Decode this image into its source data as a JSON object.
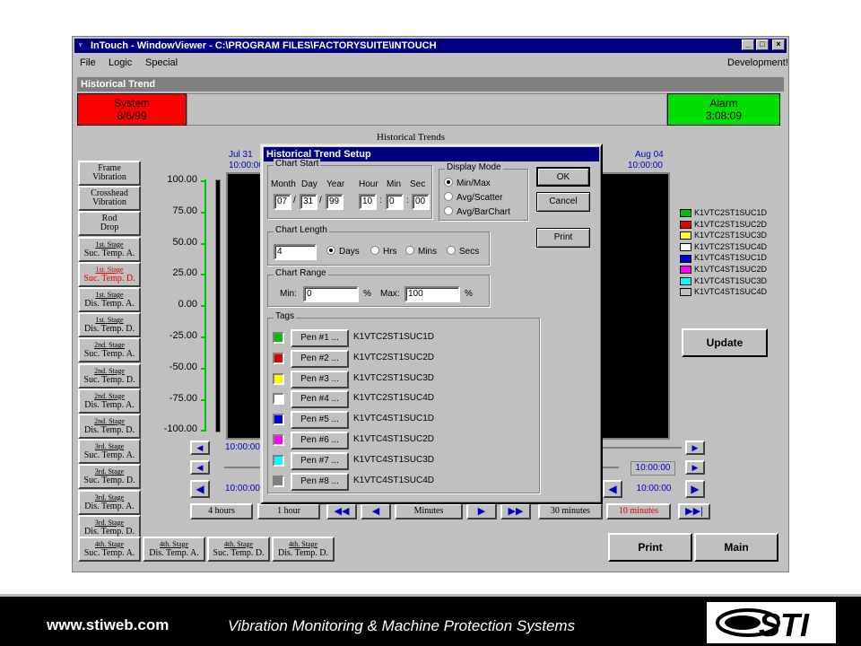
{
  "window": {
    "title": "InTouch - WindowViewer - C:\\PROGRAM FILES\\FACTORYSUITE\\INTOUCH",
    "min": "_",
    "max": "□",
    "close": "×"
  },
  "menu": {
    "file": "File",
    "logic": "Logic",
    "special": "Special",
    "right": "Development!"
  },
  "panel": {
    "title": "Historical Trend"
  },
  "system": {
    "label": "System",
    "date": "8/6/99"
  },
  "alarm": {
    "label": "Alarm",
    "time": "3:08:09"
  },
  "chart": {
    "title": "Historical Trends",
    "start_date": "Jul 31",
    "start_time": "10:00:00",
    "end_date": "Aug 04",
    "end_time": "10:00:00"
  },
  "y_ticks": [
    "100.00",
    "75.00",
    "50.00",
    "25.00",
    "0.00",
    "-25.00",
    "-50.00",
    "-75.00",
    "-100.00"
  ],
  "nav": [
    {
      "l1": "Frame",
      "l2": "Vibration"
    },
    {
      "l1": "Crosshead",
      "l2": "Vibration"
    },
    {
      "l1": "Rod",
      "l2": "Drop"
    },
    {
      "l1": "1st. Stage",
      "l2": "Suc. Temp. A."
    },
    {
      "l1": "1st. Stage",
      "l2": "Suc. Temp. D."
    },
    {
      "l1": "1st. Stage",
      "l2": "Dis. Temp. A."
    },
    {
      "l1": "1st. Stage",
      "l2": "Dis. Temp. D."
    },
    {
      "l1": "2nd. Stage",
      "l2": "Suc. Temp. A."
    },
    {
      "l1": "2nd. Stage",
      "l2": "Suc. Temp. D."
    },
    {
      "l1": "2nd. Stage",
      "l2": "Dis. Temp. A."
    },
    {
      "l1": "2nd. Stage",
      "l2": "Dis. Temp. D."
    },
    {
      "l1": "3rd. Stage",
      "l2": "Suc. Temp. A."
    },
    {
      "l1": "3rd. Stage",
      "l2": "Suc. Temp. D."
    },
    {
      "l1": "3rd. Stage",
      "l2": "Dis. Temp. A."
    },
    {
      "l1": "3rd. Stage",
      "l2": "Dis. Temp. D."
    }
  ],
  "bottom_tabs": [
    {
      "l1": "4th. Stage",
      "l2": "Suc. Temp. A."
    },
    {
      "l1": "4th. Stage",
      "l2": "Dis. Temp. A."
    },
    {
      "l1": "4th. Stage",
      "l2": "Suc. Temp. D."
    },
    {
      "l1": "4th. Stage",
      "l2": "Dis. Temp. D."
    }
  ],
  "legend": [
    {
      "tag": "K1VTC2ST1SUC1D",
      "color": "#00c000"
    },
    {
      "tag": "K1VTC2ST1SUC2D",
      "color": "#e00000"
    },
    {
      "tag": "K1VTC2ST1SUC3D",
      "color": "#ffff00"
    },
    {
      "tag": "K1VTC2ST1SUC4D",
      "color": "#ffffff"
    },
    {
      "tag": "K1VTC4ST1SUC1D",
      "color": "#0000e0"
    },
    {
      "tag": "K1VTC4ST1SUC2D",
      "color": "#ff00ff"
    },
    {
      "tag": "K1VTC4ST1SUC3D",
      "color": "#00ffff"
    },
    {
      "tag": "K1VTC4ST1SUC4D",
      "color": "#c0c0c0"
    }
  ],
  "buttons": {
    "update": "Update",
    "print": "Print",
    "main": "Main"
  },
  "scroll": {
    "time1": "10:00:00",
    "time2": "10:00:00",
    "time3": "10:00:00",
    "time4": "10:00:00"
  },
  "spans": {
    "h4": "4 hours",
    "h1": "1 hour",
    "minutes": "Minutes",
    "m30": "30 minutes",
    "m10": "10 minutes"
  },
  "dialog": {
    "title": "Historical Trend Setup",
    "chart_start": "Chart Start",
    "month": "Month",
    "day": "Day",
    "year": "Year",
    "hour": "Hour",
    "min": "Min",
    "sec": "Sec",
    "month_val": "07",
    "day_val": "31",
    "year_val": "99",
    "hour_val": "10",
    "min_val": "0",
    "sec_val": "00",
    "date_sep": "/",
    "time_sep": ":",
    "display_mode": "Display Mode",
    "mode_minmax": "Min/Max",
    "mode_avgscatter": "Avg/Scatter",
    "mode_avgbar": "Avg/BarChart",
    "ok": "OK",
    "cancel": "Cancel",
    "print": "Print",
    "chart_length": "Chart Length",
    "length_val": "4",
    "days": "Days",
    "hrs": "Hrs",
    "mins": "Mins",
    "secs": "Secs",
    "chart_range": "Chart Range",
    "min_label": "Min:",
    "max_label": "Max:",
    "max_val": "100",
    "pct": "%",
    "tags": "Tags",
    "pens": [
      {
        "label": "Pen #1 ...",
        "tag": "K1VTC2ST1SUC1D",
        "color": "#00c000"
      },
      {
        "label": "Pen #2 ...",
        "tag": "K1VTC2ST1SUC2D",
        "color": "#e00000"
      },
      {
        "label": "Pen #3 ...",
        "tag": "K1VTC2ST1SUC3D",
        "color": "#ffff00"
      },
      {
        "label": "Pen #4 ...",
        "tag": "K1VTC2ST1SUC4D",
        "color": "#ffffff"
      },
      {
        "label": "Pen #5 ...",
        "tag": "K1VTC4ST1SUC1D",
        "color": "#0000e0"
      },
      {
        "label": "Pen #6 ...",
        "tag": "K1VTC4ST1SUC2D",
        "color": "#ff00ff"
      },
      {
        "label": "Pen #7 ...",
        "tag": "K1VTC4ST1SUC3D",
        "color": "#00ffff"
      },
      {
        "label": "Pen #8 ...",
        "tag": "K1VTC4ST1SUC4D",
        "color": "#808080"
      }
    ]
  },
  "footer": {
    "url": "www.stiweb.com",
    "tagline": "Vibration Monitoring & Machine Protection Systems",
    "logo": "STI"
  }
}
